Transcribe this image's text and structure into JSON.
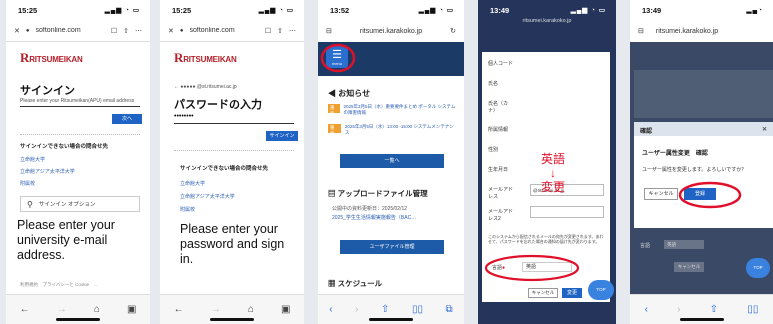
{
  "phones": {
    "p1": {
      "time": "15:25",
      "url": "soft",
      "url_rest": "online.com",
      "logo": "RITSUMEIKAN",
      "heading": "サインイン",
      "email_placeholder": "Please enter your Ritsumeikan(APU) email address",
      "next_button": "次へ",
      "help_heading": "サインインできない場合の問合せ先",
      "links": [
        "立命館大学",
        "立命館アジア太平洋大学",
        "附属校"
      ],
      "options_label": "サインイン オプション",
      "footer": "利用規約　プライバシーと Cookie　…",
      "caption": "Please enter your university e-mail address."
    },
    "p2": {
      "time": "15:25",
      "url": "soft",
      "url_rest": "online.com",
      "logo": "RITSUMEIKAN",
      "account": "@st.ritsumei.ac.jp",
      "account_masked": "●●●●●",
      "heading": "パスワードの入力",
      "password_value": "••••••••",
      "signin_button": "サインイン",
      "help_heading": "サインインできない場合の問合せ先",
      "links": [
        "立命館大学",
        "立命館アジア太平洋大学",
        "附属校"
      ],
      "caption": "Please enter your password and sign in."
    },
    "p3": {
      "time": "13:52",
      "url": "ritsumei.karakoko.jp",
      "menu_label": "menu",
      "notice_heading": "お知らせ",
      "notices": [
        {
          "badge": "重要",
          "text": "2025年3月5日（水）重要要件まとめ ポータル システムの障害情報"
        },
        {
          "badge": "重要",
          "text": "2025年3月5日（水）13:00 -15:00 システムメンテナンス"
        }
      ],
      "list_button": "一覧へ",
      "upload_heading": "アップロードファイル管理",
      "file_date_label": "公開中の資料更新日：2025/02/12",
      "file_link": "2025_学生生活情報実施報告（BAC…",
      "user_file_button": "ユーザファイル管理",
      "schedule_heading": "スケジュール"
    },
    "p4": {
      "time": "13:49",
      "url": "ritsumei.karakoko.jp",
      "fields": [
        "個人コード",
        "氏名",
        "氏名（カナ）",
        "所属情報",
        "性別",
        "生年月日",
        "メールアドレス",
        "メールアドレス2"
      ],
      "email_value": "@ritsumei.ac.jp",
      "note": "このシステムから配信されるメールの宛先が変更されます。あわせて、パスワードを忘れた場合の通知の届け先が変わります。",
      "lang_label": "言語",
      "lang_value": "英語",
      "cancel": "キャンセル",
      "change": "変更",
      "top": "TOP",
      "annotation_top": "英語",
      "annotation_arrow": "↓",
      "annotation_bottom": "変更"
    },
    "p5": {
      "time": "13:49",
      "url": "ritsumei.karakoko.jp",
      "dialog_title": "確認",
      "dialog_heading": "ユーザー属性変更　確認",
      "dialog_message": "ユーザー属性を変更します。よろしいですか？",
      "cancel": "キャンセル",
      "register": "登録",
      "lang_label": "言語",
      "lang_value": "英語",
      "cancel2": "キャンセル",
      "top": "TOP"
    }
  },
  "colors": {
    "annotation": "#e0102a",
    "primary": "#1f63c4",
    "brand": "#b5202a",
    "orange_badge": "#f0a030"
  }
}
